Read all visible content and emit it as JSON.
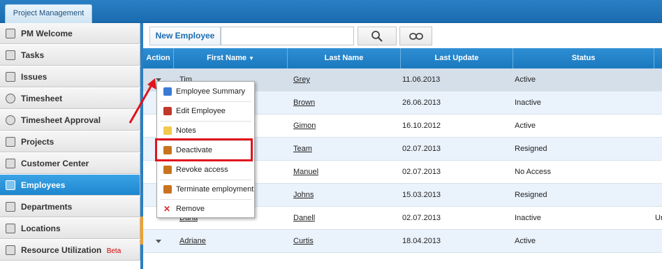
{
  "top_tab": {
    "label": "Project Management"
  },
  "sidebar": {
    "items": [
      {
        "label": "PM Welcome",
        "icon": "dashboard-icon"
      },
      {
        "label": "Tasks",
        "icon": "tasks-icon"
      },
      {
        "label": "Issues",
        "icon": "issues-icon"
      },
      {
        "label": "Timesheet",
        "icon": "clock-icon"
      },
      {
        "label": "Timesheet Approval",
        "icon": "check-circle-icon"
      },
      {
        "label": "Projects",
        "icon": "folder-icon"
      },
      {
        "label": "Customer Center",
        "icon": "customer-icon"
      },
      {
        "label": "Employees",
        "icon": "employees-icon",
        "active": true
      },
      {
        "label": "Departments",
        "icon": "cube-icon"
      },
      {
        "label": "Locations",
        "icon": "flag-icon"
      },
      {
        "label": "Resource Utilization",
        "icon": "resource-icon",
        "badge": "Beta"
      }
    ]
  },
  "toolbar": {
    "new_label": "New Employee",
    "search_value": "",
    "search_icon": "magnifier-icon",
    "reset_icon": "link-icon"
  },
  "grid": {
    "columns": [
      "Action",
      "First Name",
      "Last Name",
      "Last Update",
      "Status"
    ],
    "sort_column": "First Name",
    "rows": [
      {
        "first": "Tim",
        "last": "Grey",
        "updated": "11.06.2013",
        "status": "Active"
      },
      {
        "first": "",
        "last": "Brown",
        "updated": "26.06.2013",
        "status": "Inactive"
      },
      {
        "first": "",
        "last": "Gimon",
        "updated": "16.10.2012",
        "status": "Active"
      },
      {
        "first": "",
        "last": "Team",
        "updated": "02.07.2013",
        "status": "Resigned"
      },
      {
        "first": "",
        "last": "Manuel",
        "updated": "02.07.2013",
        "status": "No Access"
      },
      {
        "first": "",
        "last": "Johns",
        "updated": "15.03.2013",
        "status": "Resigned"
      },
      {
        "first": "Dana",
        "last": "Danell",
        "updated": "02.07.2013",
        "status": "Inactive",
        "extra": "Ur"
      },
      {
        "first": "Adriane",
        "last": "Curtis",
        "updated": "18.04.2013",
        "status": "Active"
      }
    ]
  },
  "context_menu": {
    "items": [
      {
        "label": "Employee Summary",
        "icon": "summary-icon",
        "color": "#3a7bd5"
      },
      {
        "label": "Edit Employee",
        "icon": "edit-chart-icon",
        "color": "#c0392b"
      },
      {
        "label": "Notes",
        "icon": "notes-icon",
        "color": "#f2c94c"
      },
      {
        "label": "Deactivate",
        "icon": "user-lock-icon",
        "color": "#c8731f"
      },
      {
        "label": "Revoke access",
        "icon": "user-lock-icon",
        "color": "#c8731f"
      },
      {
        "label": "Terminate employment",
        "icon": "user-lock-icon",
        "color": "#c8731f"
      },
      {
        "label": "Remove",
        "icon": "remove-x-icon",
        "color": "#d62f2f"
      }
    ],
    "highlighted": "Deactivate"
  }
}
